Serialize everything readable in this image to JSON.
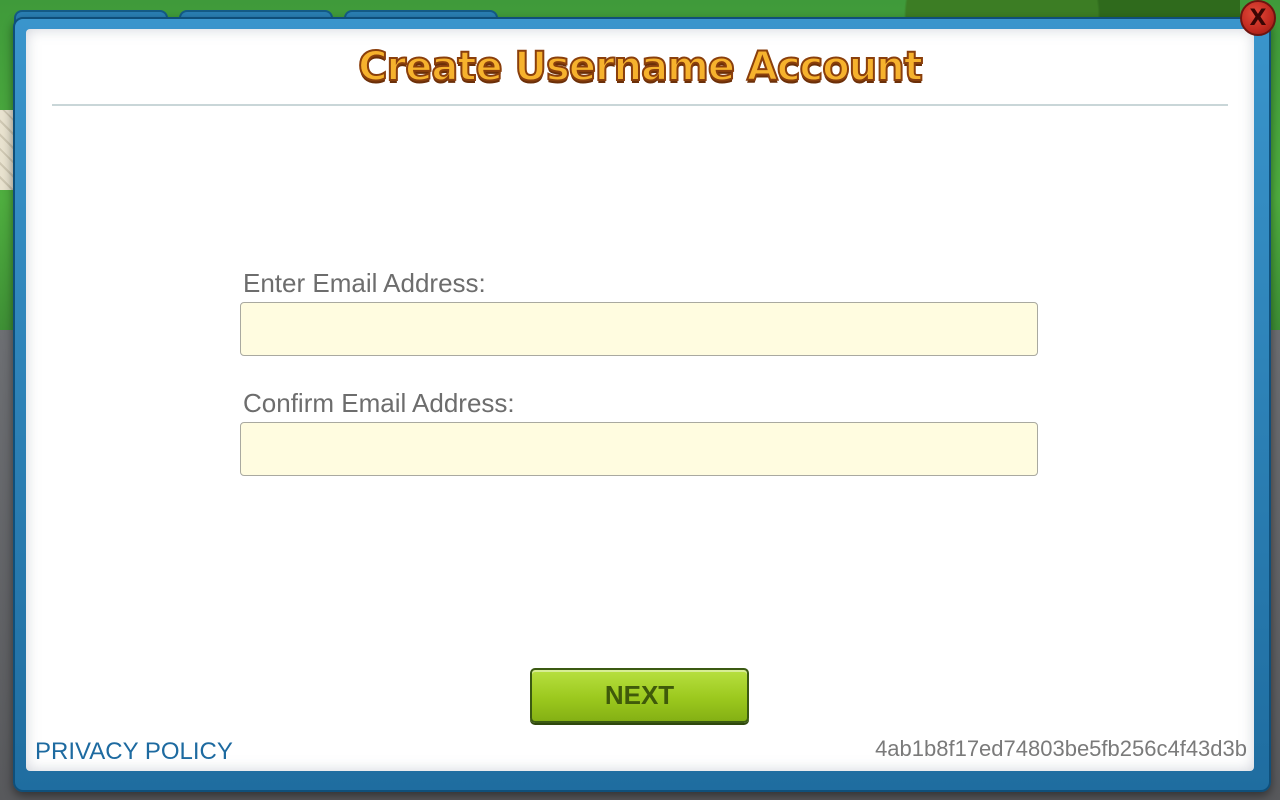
{
  "dialog": {
    "title": "Create Username Account",
    "email_label": "Enter Email Address:",
    "email_value": "",
    "confirm_label": "Confirm Email Address:",
    "confirm_value": "",
    "next_label": "NEXT",
    "privacy_label": "PRIVACY POLICY",
    "hash_text": "4ab1b8f17ed74803be5fb256c4f43d3b",
    "close_label": "X"
  },
  "colors": {
    "title_fill": "#f6b22d",
    "title_stroke": "#8a3f0c",
    "input_bg": "#fffce0",
    "next_button": "#9cc91e",
    "frame": "#2a7fb4",
    "privacy_link": "#1d6aa0",
    "close_button": "#c0291f"
  }
}
